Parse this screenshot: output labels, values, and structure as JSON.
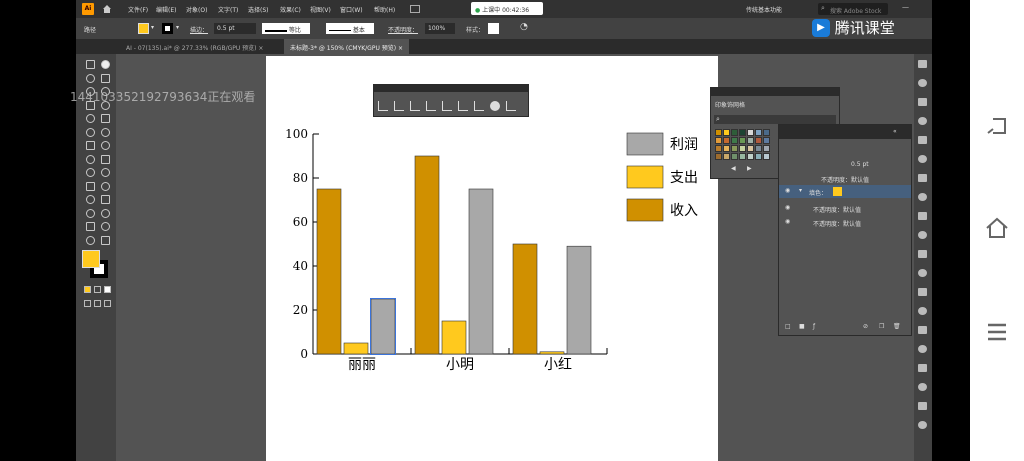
{
  "app": {
    "logo": "Ai",
    "menus": [
      "文件(F)",
      "编辑(E)",
      "对象(O)",
      "文字(T)",
      "选择(S)",
      "效果(C)",
      "视图(V)",
      "窗口(W)",
      "帮助(H)"
    ],
    "workspace": "传统基本功能",
    "search_placeholder": "搜索 Adobe Stock"
  },
  "live_badge": "上课中 00:42:36",
  "brand": "腾讯课堂",
  "watermark": "14410335219279363​4正在观看",
  "control_bar": {
    "mode": "路径",
    "stroke_label": "描边：",
    "stroke_value": "0.5 pt",
    "profile": "等比",
    "brush": "基本",
    "opacity_label": "不透明度：",
    "opacity_value": "100%",
    "style_label": "样式："
  },
  "tabs": [
    {
      "label": "AI - 07(135).ai* @ 277.33% (RGB/GPU 预览)",
      "active": false
    },
    {
      "label": "未标题-3* @ 150% (CMYK/GPU 预览)",
      "active": true
    }
  ],
  "swatches_panel": {
    "title": "印象饰网格"
  },
  "appearance_panel": {
    "stroke_value": "0.5 pt",
    "row1": "不透明度：默认值",
    "fill_label": "填色：",
    "row2": "不透明度：默认值",
    "row3": "不透明度：默认值"
  },
  "colors": {
    "income": "#D09000",
    "expense": "#FFC91E",
    "profit": "#A8A8A8",
    "fill_swatch": "#FFC91E"
  },
  "chart_data": {
    "type": "bar",
    "categories": [
      "丽丽",
      "小明",
      "小红"
    ],
    "series": [
      {
        "name": "收入",
        "values": [
          75,
          90,
          50
        ]
      },
      {
        "name": "支出",
        "values": [
          5,
          15,
          1
        ]
      },
      {
        "name": "利润",
        "values": [
          25,
          75,
          49
        ]
      }
    ],
    "ylim": [
      0,
      100
    ],
    "yticks": [
      "0",
      "20",
      "40",
      "60",
      "80",
      "100"
    ],
    "legend_placement": "right",
    "legend": [
      "利润",
      "支出",
      "收入"
    ]
  }
}
